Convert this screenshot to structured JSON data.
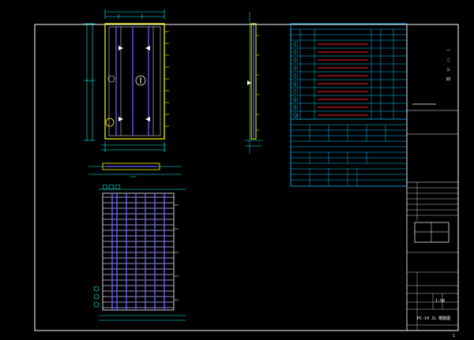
{
  "drawing": {
    "titles": {
      "plan": "",
      "section": "",
      "rebar": "",
      "table_header": "",
      "table2_header": "",
      "table3_header": "",
      "drawing_name": "PC-14 JL-钢筋图"
    },
    "rebar_table": {
      "columns": [
        "编号",
        "钢筋简图",
        "直径",
        "长度",
        "根数",
        "重量"
      ],
      "rows": [
        {
          "id": "1",
          "dia": "",
          "len": "",
          "qty": "",
          "wt": ""
        },
        {
          "id": "2",
          "dia": "",
          "len": "",
          "qty": "",
          "wt": ""
        },
        {
          "id": "3",
          "dia": "",
          "len": "",
          "qty": "",
          "wt": ""
        },
        {
          "id": "4",
          "dia": "",
          "len": "",
          "qty": "",
          "wt": ""
        },
        {
          "id": "5",
          "dia": "",
          "len": "",
          "qty": "",
          "wt": ""
        },
        {
          "id": "6",
          "dia": "",
          "len": "",
          "qty": "",
          "wt": ""
        },
        {
          "id": "7",
          "dia": "",
          "len": "",
          "qty": "",
          "wt": ""
        },
        {
          "id": "8",
          "dia": "",
          "len": "",
          "qty": "",
          "wt": ""
        },
        {
          "id": "9",
          "dia": "",
          "len": "",
          "qty": "",
          "wt": ""
        },
        {
          "id": "10",
          "dia": "",
          "len": "",
          "qty": "",
          "wt": ""
        }
      ]
    },
    "title_block": {
      "side_notes": [
        "一",
        "二",
        "三",
        "四"
      ],
      "scale": "1:50",
      "sheet": "1"
    }
  },
  "colors": {
    "bg": "#000000",
    "frame": "#ffffff",
    "concrete": "#ffff00",
    "rebar_main": "#6a5cff",
    "rebar_sec": "#c8c8ff",
    "dim": "#00ffff",
    "table": "#00c8ff",
    "red": "#ff2020",
    "green": "#00ff00"
  }
}
